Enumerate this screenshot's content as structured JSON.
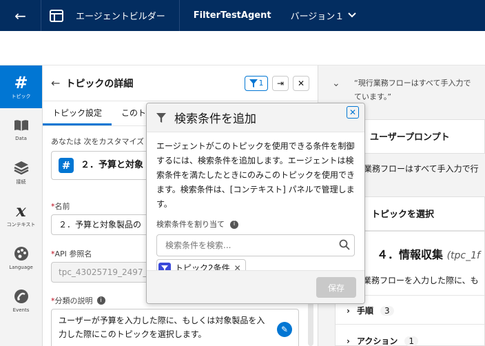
{
  "topbar": {
    "title": "エージェントビルダー",
    "agent": "FilterTestAgent",
    "version": "バージョン１"
  },
  "rail": {
    "items": [
      {
        "label": "トピック",
        "icon": "hash-icon"
      },
      {
        "label": "Data",
        "icon": "book-icon"
      },
      {
        "label": "接続",
        "icon": "layers-icon"
      },
      {
        "label": "コンテキスト",
        "icon": "variable-x-icon"
      },
      {
        "label": "Language",
        "icon": "palette-icon"
      },
      {
        "label": "Events",
        "icon": "events-icon"
      }
    ]
  },
  "panel": {
    "title": "トピックの詳細",
    "filter_count": "1",
    "tabs": [
      "トピック設定",
      "このト"
    ],
    "customize_text": "あなたは 次をカスタマイズ",
    "topic_name_card": "２．予算と対象",
    "name_label": "名前",
    "name_value": "２．予算と対象製品の",
    "api_label": "API 参照名",
    "api_value": "tpc_43025719_2497_a",
    "desc_label": "分類の説明",
    "desc_value_line1": "ユーザーが予算を入力した際に、もしくは対象製品を入",
    "desc_value_line2": "力した際にこのトピックを選択します。"
  },
  "right": {
    "quote_line1": "“現行業務フローはすべて手入力で",
    "quote_line2": "ています。”",
    "user_prompt": "ユーザープロンプト",
    "user_prompt_text": "業務フローはすべて手入力で行",
    "select_topic": "トピックを選択",
    "topic_title": "４．情報収集",
    "topic_api": "(tpc_1f",
    "topic_text": "業務フローを入力した際に、も",
    "steps_label": "手順",
    "steps_count": "3",
    "actions_label": "アクション",
    "actions_count": "1"
  },
  "popover": {
    "title": "検索条件を追加",
    "description": "エージェントがこのトピックを使用できる条件を制御するには、検索条件を追加します。エージェントは検索条件を満たしたときにのみこのトピックを使用できます。検索条件は、[コンテキスト] パネルで管理します。",
    "assign_label": "検索条件を割り当て",
    "search_placeholder": "検索条件を検索...",
    "pill_label": "トピック2条件",
    "save_label": "保存"
  },
  "colors": {
    "topbar": "#032d60",
    "brand": "#0176d3",
    "pill_icon": "#3a49da"
  }
}
